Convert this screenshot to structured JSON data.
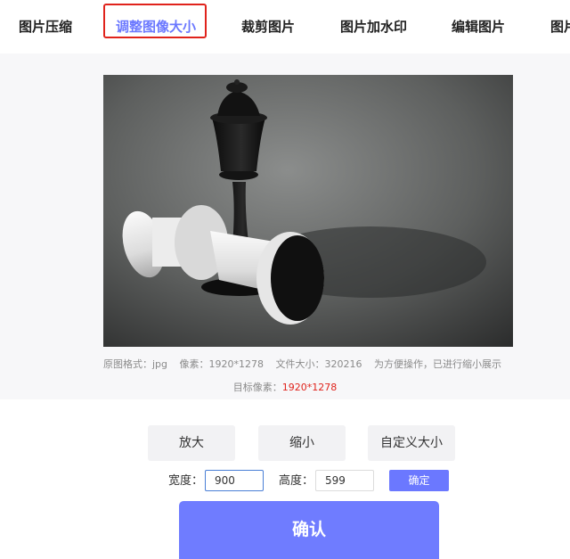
{
  "nav": {
    "tabs": [
      {
        "label": "图片压缩"
      },
      {
        "label": "调整图像大小"
      },
      {
        "label": "裁剪图片"
      },
      {
        "label": "图片加水印"
      },
      {
        "label": "编辑图片"
      },
      {
        "label": "图片"
      }
    ],
    "active_tab": 1,
    "accent_color": "#6b78ff",
    "highlight_color": "#e0231c"
  },
  "image_info": {
    "format": "原图格式：jpg",
    "pixels": "像素：1920*1278",
    "filesize": "文件大小：320216",
    "note": "为方便操作，已进行缩小展示"
  },
  "target": {
    "label": "目标像素：",
    "value": "1920*1278"
  },
  "resize_modes": {
    "enlarge": "放大",
    "shrink": "缩小",
    "custom": "自定义大小"
  },
  "dimensions": {
    "width_label": "宽度：",
    "width_value": "900",
    "height_label": "高度：",
    "height_value": "599",
    "apply_label": "确定"
  },
  "confirm_label": "确认"
}
